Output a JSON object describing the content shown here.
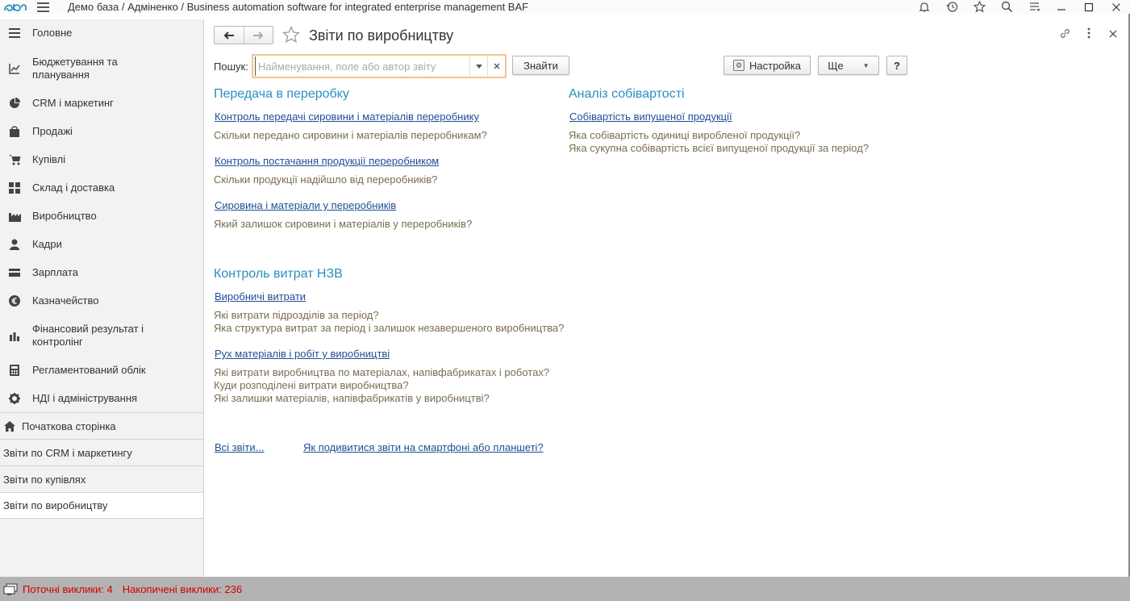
{
  "titlebar": {
    "title": "Демо база / Адміненко / Business automation software for integrated enterprise management BAF",
    "icons": [
      "bell-icon",
      "history-icon",
      "star-icon",
      "search-icon",
      "menu-icon"
    ],
    "window_controls": [
      "minimize",
      "maximize",
      "close"
    ]
  },
  "sidebar": {
    "items": [
      {
        "label": "Головне",
        "icon": "menu-icon"
      },
      {
        "label": "Бюджетування та планування",
        "icon": "chart-line-icon"
      },
      {
        "label": "CRM і маркетинг",
        "icon": "pie-chart-icon"
      },
      {
        "label": "Продажі",
        "icon": "shopping-bag-icon"
      },
      {
        "label": "Купівлі",
        "icon": "cart-icon"
      },
      {
        "label": "Склад і доставка",
        "icon": "grid-icon"
      },
      {
        "label": "Виробництво",
        "icon": "factory-icon"
      },
      {
        "label": "Кадри",
        "icon": "person-icon"
      },
      {
        "label": "Зарплата",
        "icon": "wallet-icon"
      },
      {
        "label": "Казначейство",
        "icon": "currency-icon"
      },
      {
        "label": "Фінансовий результат і контролінг",
        "icon": "bar-chart-icon"
      },
      {
        "label": "Регламентований облік",
        "icon": "calculator-icon"
      },
      {
        "label": "НДІ і адміністрування",
        "icon": "gear-icon"
      }
    ],
    "open_windows": [
      {
        "label": "Початкова сторінка",
        "icon": "home-icon"
      },
      {
        "label": "Звіти по CRM і маркетингу"
      },
      {
        "label": "Звіти по купівлях"
      },
      {
        "label": "Звіти по виробництву"
      }
    ]
  },
  "main": {
    "title": "Звіти по виробництву",
    "search": {
      "label": "Пошук:",
      "placeholder": "Найменування, поле або автор звіту",
      "value": ""
    },
    "buttons": {
      "find": "Знайти",
      "settings": "Настройка",
      "more": "Ще",
      "help": "?"
    },
    "sections": {
      "processing": {
        "title": "Передача в переробку",
        "reports": [
          {
            "link": "Контроль передачі сировини і матеріалів переробнику",
            "desc": [
              "Скільки передано сировини і матеріалів переробникам?"
            ]
          },
          {
            "link": "Контроль постачання продукції переробником",
            "desc": [
              "Скільки продукції надійшло від переробників?"
            ]
          },
          {
            "link": "Сировина і матеріали у переробників",
            "desc": [
              "Який залишок сировини і матеріалів у переробників?"
            ]
          }
        ]
      },
      "cost": {
        "title": "Аналіз собівартості",
        "reports": [
          {
            "link": "Собівартість випущеної продукції",
            "desc": [
              "Яка собівартість одиниці виробленої продукції?",
              "Яка сукупна собівартість всієї випущеної продукції за період?"
            ]
          }
        ]
      },
      "wip": {
        "title": "Контроль витрат НЗВ",
        "reports": [
          {
            "link": "Виробничі витрати",
            "desc": [
              "Які витрати підрозділів за період?",
              "Яка структура витрат за період і залишок незавершеного виробництва?"
            ]
          },
          {
            "link": "Рух матеріалів і робіт у виробництві",
            "desc": [
              "Які витрати виробництва по матеріалах, напівфабрикатах і роботах?",
              "Куди розподілені витрати виробництва?",
              "Які залишки матеріалів, напівфабрикатів у виробництві?"
            ]
          }
        ]
      }
    },
    "footer_links": {
      "all_reports": "Всі звіти...",
      "mobile": "Як подивитися звіти на смартфоні або планшеті?"
    }
  },
  "statusbar": {
    "current_calls": "Поточні виклики: 4",
    "accumulated_calls": "Накопичені виклики: 236"
  },
  "colors": {
    "section_title": "#2a8fc1",
    "link": "#1f4e94",
    "description": "#7a6c51",
    "search_focus": "#f7c28a",
    "status_text": "#d40000"
  }
}
